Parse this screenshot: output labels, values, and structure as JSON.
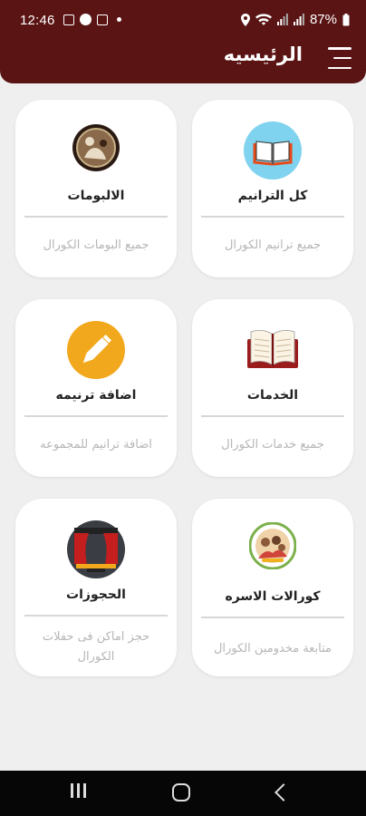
{
  "status_bar": {
    "time": "12:46",
    "battery": "87%",
    "icons": [
      "image-icon",
      "messenger-icon",
      "cast-icon",
      "dot-icon",
      "location-icon",
      "wifi-icon",
      "signal-icon",
      "signal-icon",
      "battery-icon"
    ]
  },
  "app_bar": {
    "title": "الرئيسيه",
    "menu_icon": "hamburger-icon",
    "background_color": "#5a1414"
  },
  "cards": [
    {
      "id": "all-hymns",
      "title": "كل الترانيم",
      "description": "جميع ترانيم الكورال",
      "icon": "book-icon"
    },
    {
      "id": "albums",
      "title": "الالبومات",
      "description": "جميع البومات الكورال",
      "icon": "album-icon"
    },
    {
      "id": "services",
      "title": "الخدمات",
      "description": "جميع خدمات الكورال",
      "icon": "open-book-icon"
    },
    {
      "id": "add-hymn",
      "title": "اضافة ترنيمه",
      "description": "اضافة ترانيم للمجموعه",
      "icon": "pencil-icon"
    },
    {
      "id": "family-choirs",
      "title": "كورالات الاسره",
      "description": "متابعة مخدومين الكورال",
      "icon": "family-icon"
    },
    {
      "id": "reservations",
      "title": "الحجوزات",
      "description": "حجز اماكن فى حفلات الكورال",
      "icon": "stage-icon"
    }
  ],
  "nav_bar": {
    "recents_icon": "recents-icon",
    "home_icon": "home-icon",
    "back_icon": "back-icon"
  }
}
